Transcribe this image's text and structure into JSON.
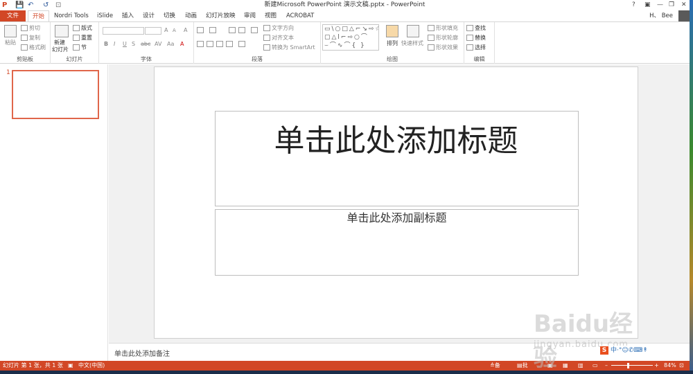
{
  "window": {
    "title": "新建Microsoft PowerPoint 演示文稿.pptx - PowerPoint",
    "controls": [
      "?",
      "▣",
      "—",
      "❐",
      "✕"
    ]
  },
  "quick_access": {
    "save": "💾",
    "undo": "↶",
    "redo": "↺",
    "more": "⊡"
  },
  "tabs": [
    "文件",
    "开始",
    "Nordri Tools",
    "iSlide",
    "插入",
    "设计",
    "切换",
    "动画",
    "幻灯片放映",
    "审阅",
    "视图",
    "ACROBAT"
  ],
  "user": {
    "name": "H、 Bee"
  },
  "ribbon": {
    "clipboard": {
      "label": "剪贴板",
      "paste": "粘贴",
      "cut": "剪切",
      "copy": "复制",
      "format_painter": "格式刷"
    },
    "slides": {
      "label": "幻灯片",
      "new_slide": "新建",
      "new_slide_2": "幻灯片",
      "layout": "版式",
      "reset": "重置",
      "section": "节"
    },
    "font": {
      "label": "字体",
      "bold": "B",
      "italic": "I",
      "underline": "U",
      "shadow": "S",
      "strike": "abc",
      "spacing": "AV",
      "case": "Aa",
      "grow": "A",
      "shrink": "A",
      "clear": "A"
    },
    "paragraph": {
      "label": "段落",
      "text_direction": "文字方向",
      "align_text": "对齐文本",
      "smartart": "转换为 SmartArt"
    },
    "drawing": {
      "label": "绘图",
      "shapes": "▭\\○□△⌐↘⇨☆ ▢△ⅼ⌐⇨○⌒ ⌣⌒∿⌒{ }",
      "arrange": "排列",
      "quick_styles": "快速样式",
      "fill": "形状填充",
      "outline": "形状轮廓",
      "effects": "形状效果"
    },
    "editing": {
      "label": "编辑",
      "find": "查找",
      "replace": "替换",
      "select": "选择"
    }
  },
  "thumbnail": {
    "number": "1"
  },
  "slide": {
    "title_placeholder": "单击此处添加标题",
    "subtitle_placeholder": "单击此处添加副标题"
  },
  "notes": {
    "placeholder": "单击此处添加备注"
  },
  "status": {
    "slide_info": "幻灯片 第 1 张，共 1 张",
    "language": "中文(中国)",
    "notes_btn": "备注",
    "comments_btn": "批注",
    "zoom": "84%"
  },
  "watermark": {
    "brand": "Baidu经验",
    "url": "jingyan.baidu.com"
  },
  "ime": {
    "text": "中·°☺✆⌨↟"
  },
  "colors": {
    "accent": "#d24726",
    "thumb_border": "#e0664a"
  }
}
